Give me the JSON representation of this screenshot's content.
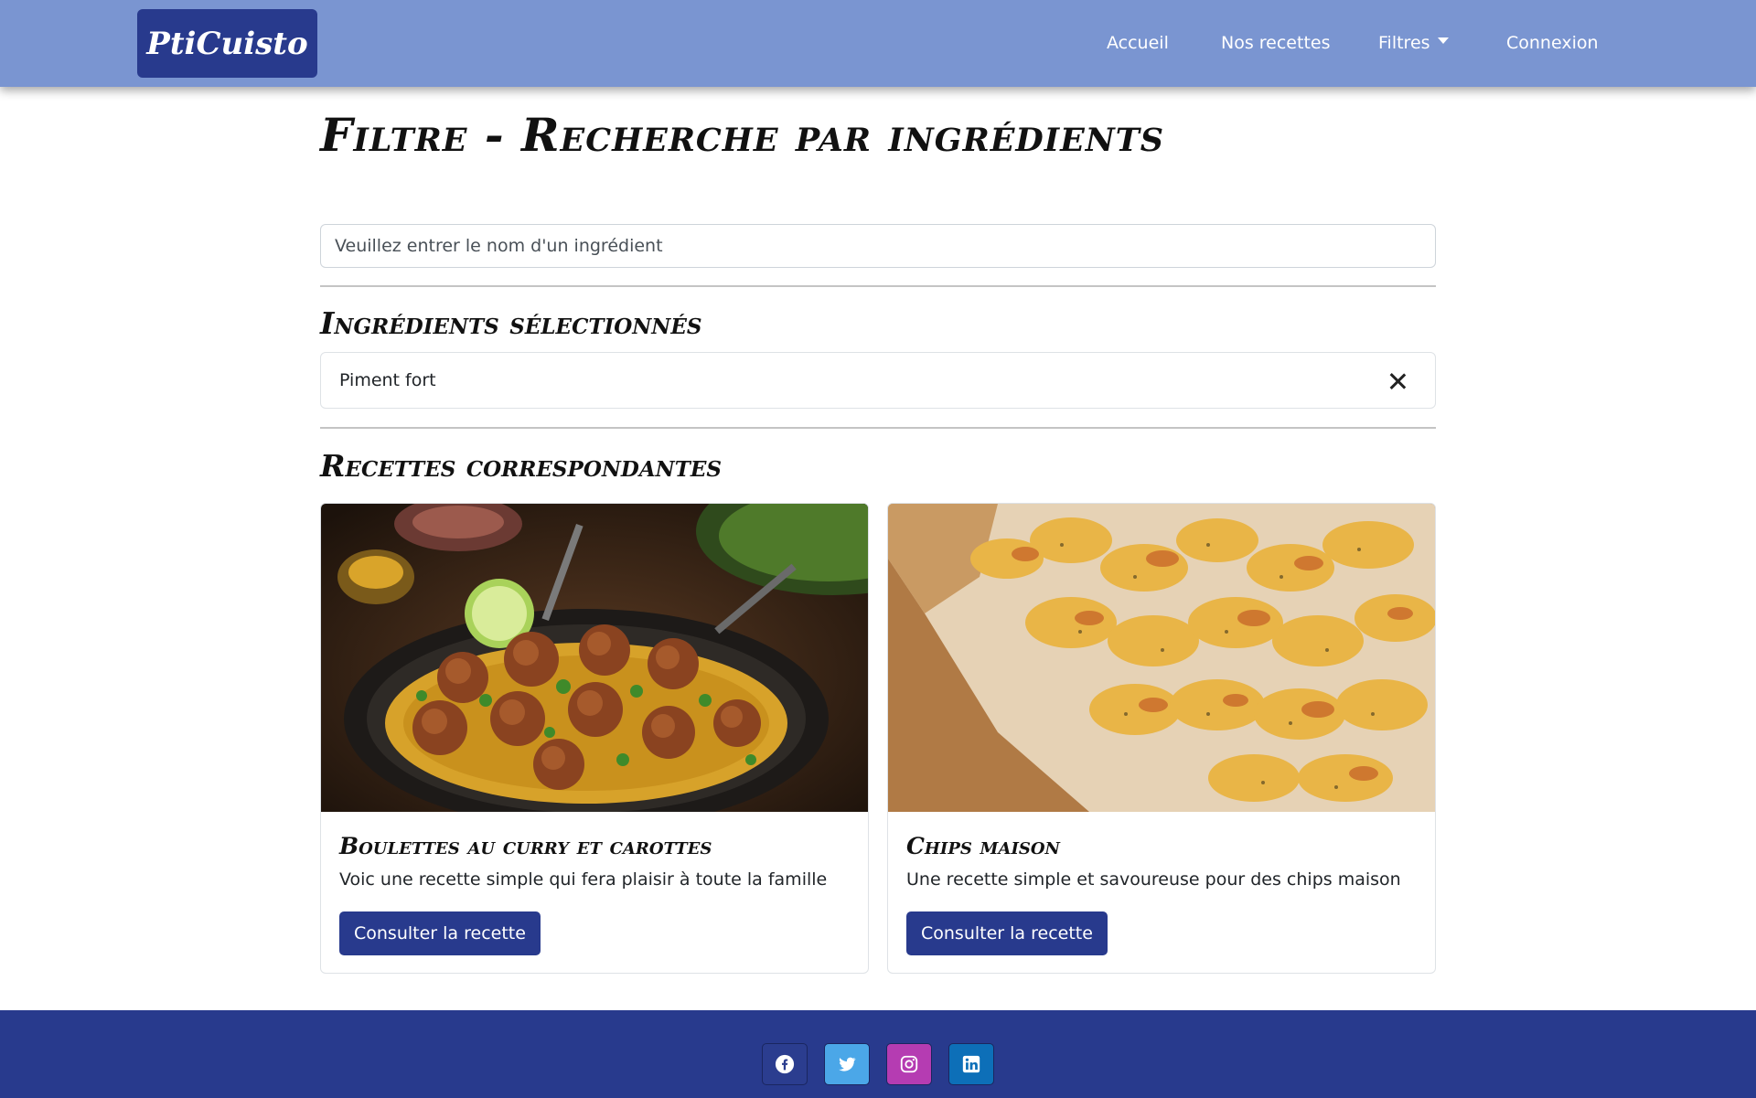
{
  "navbar": {
    "brand": "PtiCuisto",
    "links": [
      {
        "label": "Accueil"
      },
      {
        "label": "Nos recettes"
      },
      {
        "label": "Filtres"
      },
      {
        "label": "Connexion"
      }
    ]
  },
  "page": {
    "title": "Filtre - Recherche par ingrédients",
    "search": {
      "placeholder": "Veuillez entrer le nom d'un ingrédient",
      "value": ""
    },
    "selected_heading": "Ingrédients sélectionnés",
    "selected_ingredients": [
      "Piment fort"
    ],
    "results_heading": "Recettes correspondantes"
  },
  "recipes": [
    {
      "title": "Boulettes au curry et carottes",
      "description": "Voic une recette simple qui fera plaisir à toute la famille",
      "button": "Consulter la recette"
    },
    {
      "title": "Chips maison",
      "description": "Une recette simple et savoureuse pour des chips maison",
      "button": "Consulter la recette"
    }
  ],
  "footer": {
    "social": [
      {
        "icon": "facebook-icon",
        "color": "#2b3d8f"
      },
      {
        "icon": "twitter-icon",
        "color": "#4ba7e8"
      },
      {
        "icon": "instagram-icon",
        "color": "#b53cb2"
      },
      {
        "icon": "linkedin-icon",
        "color": "#0d6fb8"
      }
    ]
  },
  "colors": {
    "navbar": "#7a95d1",
    "brand": "#283a8d",
    "button": "#283a8d",
    "footer": "#283a8d"
  }
}
